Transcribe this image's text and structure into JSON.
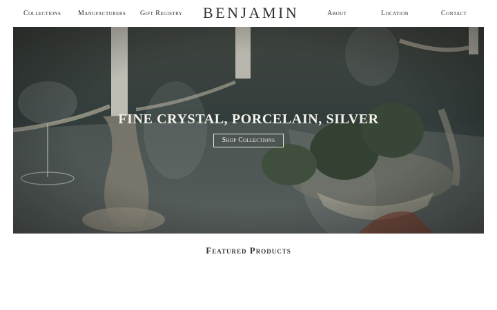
{
  "nav": {
    "collections": "Collections",
    "manufacturers": "Manufacturers",
    "gift_registry": "Gift Registry",
    "logo": "BENJAMIN",
    "about": "About",
    "location": "Location",
    "contact": "Contact"
  },
  "hero": {
    "title": "FINE CRYSTAL, PORCELAIN, SILVER",
    "button": "Shop Collections",
    "image": "table-setting-crystal-silver-photo"
  },
  "featured": {
    "heading": "Featured Products"
  }
}
